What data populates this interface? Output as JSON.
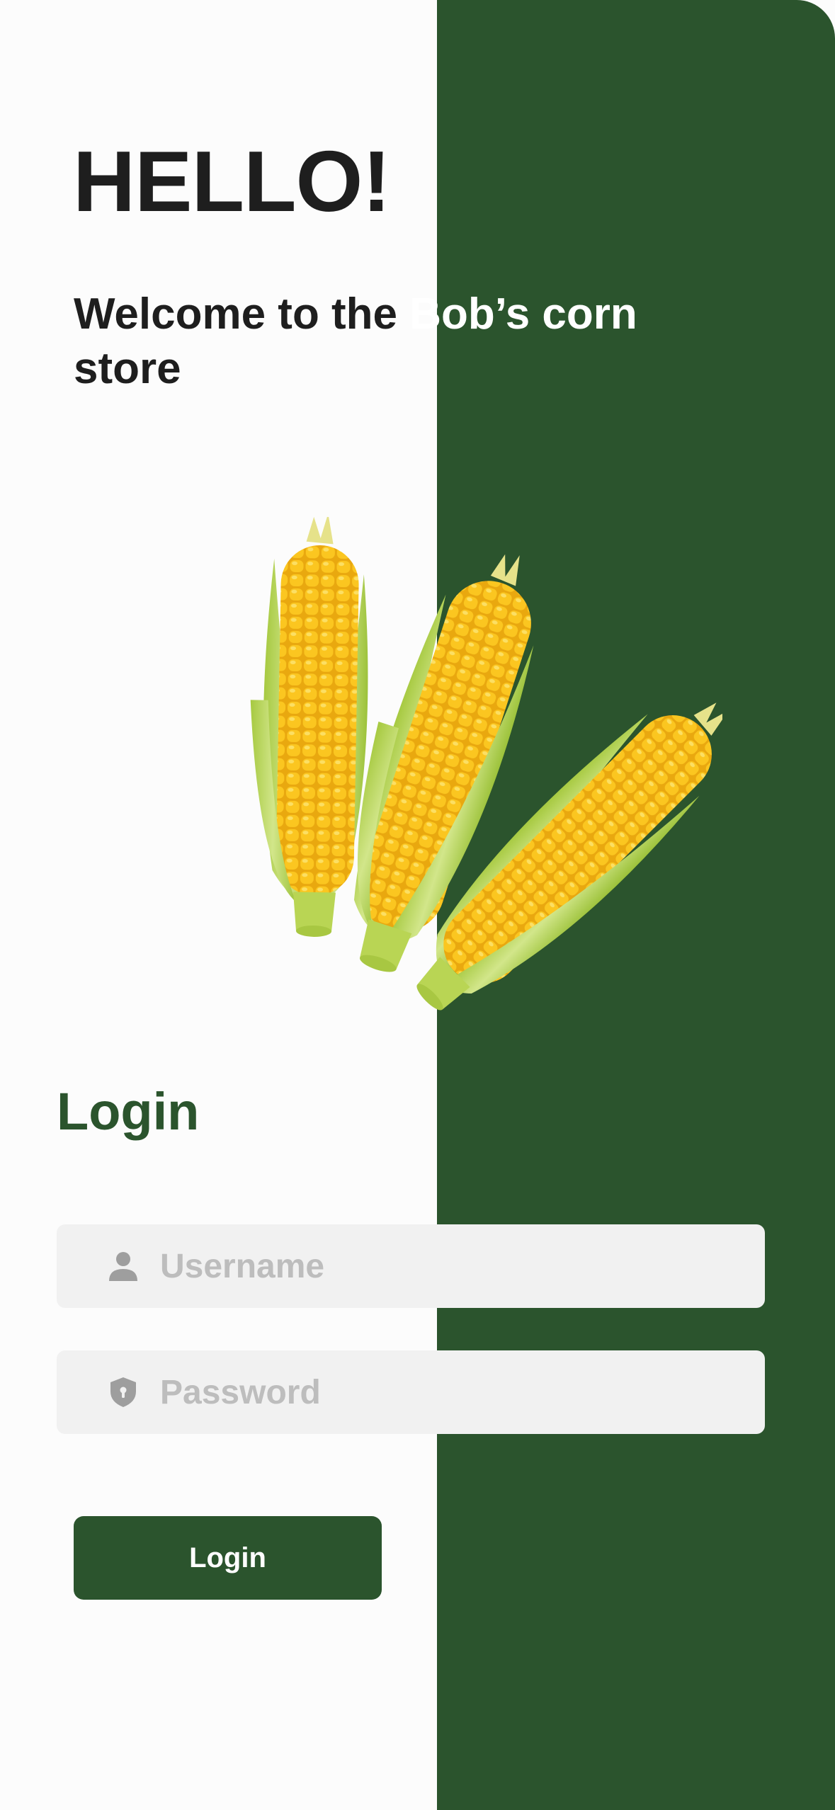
{
  "colors": {
    "brand_green": "#2b542d",
    "field_bg": "#f1f1f1",
    "text_dark": "#1e1e1e",
    "placeholder": "#bdbdbd"
  },
  "header": {
    "greeting": "HELLO!",
    "welcome_dark": "Welcome  to the ",
    "welcome_light": "Bob’s corn",
    "welcome_end": "store"
  },
  "hero": {
    "image": "corn-cobs-illustration"
  },
  "login": {
    "title": "Login",
    "username": {
      "icon": "user-icon",
      "placeholder": "Username",
      "value": ""
    },
    "password": {
      "icon": "shield-lock-icon",
      "placeholder": "Password",
      "value": ""
    },
    "button_label": "Login"
  }
}
